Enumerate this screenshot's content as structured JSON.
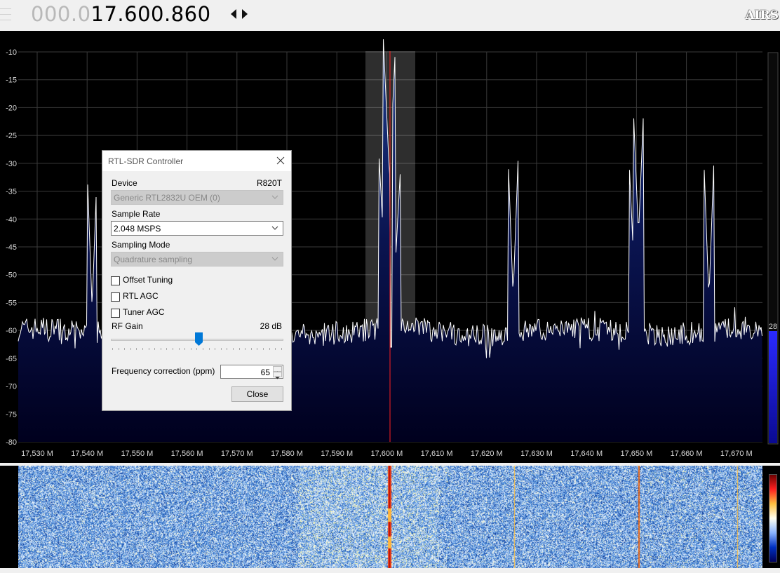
{
  "frequency": {
    "dim_part": "000.0",
    "bright_part": "17.600.860"
  },
  "logo": "AIRS",
  "spectrum": {
    "y_labels": [
      "-10",
      "-15",
      "-20",
      "-25",
      "-30",
      "-35",
      "-40",
      "-45",
      "-50",
      "-55",
      "-60",
      "-65",
      "-70",
      "-75",
      "-80"
    ],
    "x_labels": [
      "17,530 M",
      "17,540 M",
      "17,550 M",
      "17,560 M",
      "17,570 M",
      "17,580 M",
      "17,590 M",
      "17,600 M",
      "17,610 M",
      "17,620 M",
      "17,630 M",
      "17,640 M",
      "17,650 M",
      "17,660 M",
      "17,670 M"
    ],
    "gain_indicator": "28",
    "colors": {
      "fill_top": "#1e3c8c",
      "fill_bottom": "#00001e",
      "center_line": "#ff2020",
      "trace": "#ffffff",
      "grid": "#3a3a3a"
    }
  },
  "dialog": {
    "title": "RTL-SDR Controller",
    "device_label": "Device",
    "tuner": "R820T",
    "device_value": "Generic RTL2832U OEM (0)",
    "sample_rate_label": "Sample Rate",
    "sample_rate_value": "2.048 MSPS",
    "sampling_mode_label": "Sampling Mode",
    "sampling_mode_value": "Quadrature sampling",
    "offset_tuning": "Offset Tuning",
    "rtl_agc": "RTL AGC",
    "tuner_agc": "Tuner AGC",
    "rf_gain_label": "RF Gain",
    "rf_gain_value": "28 dB",
    "rf_gain_level": 0.51,
    "freq_correction_label": "Frequency correction (ppm)",
    "freq_correction_value": "65",
    "close_button": "Close"
  }
}
